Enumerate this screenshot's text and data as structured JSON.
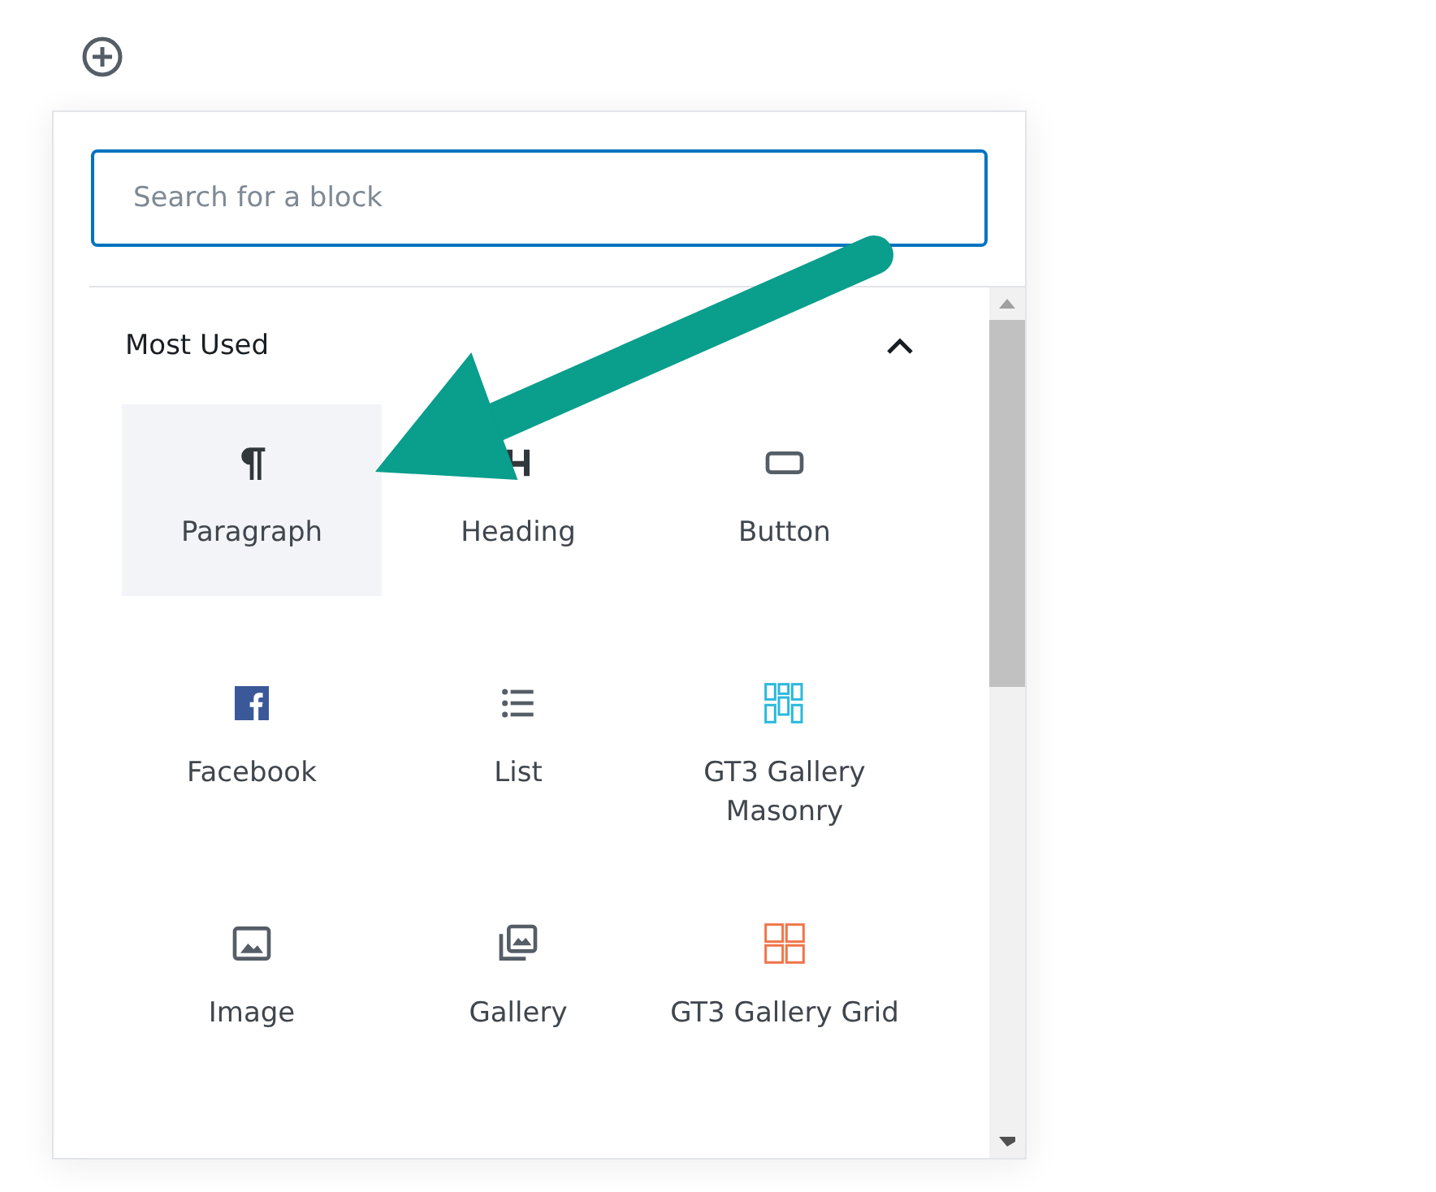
{
  "search": {
    "placeholder": "Search for a block"
  },
  "section": {
    "title": "Most Used",
    "expanded": true
  },
  "blocks": [
    {
      "label": "Paragraph",
      "kind": "paragraph",
      "selected": true
    },
    {
      "label": "Heading",
      "kind": "heading",
      "selected": false
    },
    {
      "label": "Button",
      "kind": "button",
      "selected": false
    },
    {
      "label": "Facebook",
      "kind": "facebook",
      "selected": false
    },
    {
      "label": "List",
      "kind": "list",
      "selected": false
    },
    {
      "label": "GT3 Gallery Masonry",
      "kind": "masonry",
      "selected": false
    },
    {
      "label": "Image",
      "kind": "image",
      "selected": false
    },
    {
      "label": "Gallery",
      "kind": "gallery",
      "selected": false
    },
    {
      "label": "GT3 Gallery Grid",
      "kind": "grid",
      "selected": false
    }
  ]
}
